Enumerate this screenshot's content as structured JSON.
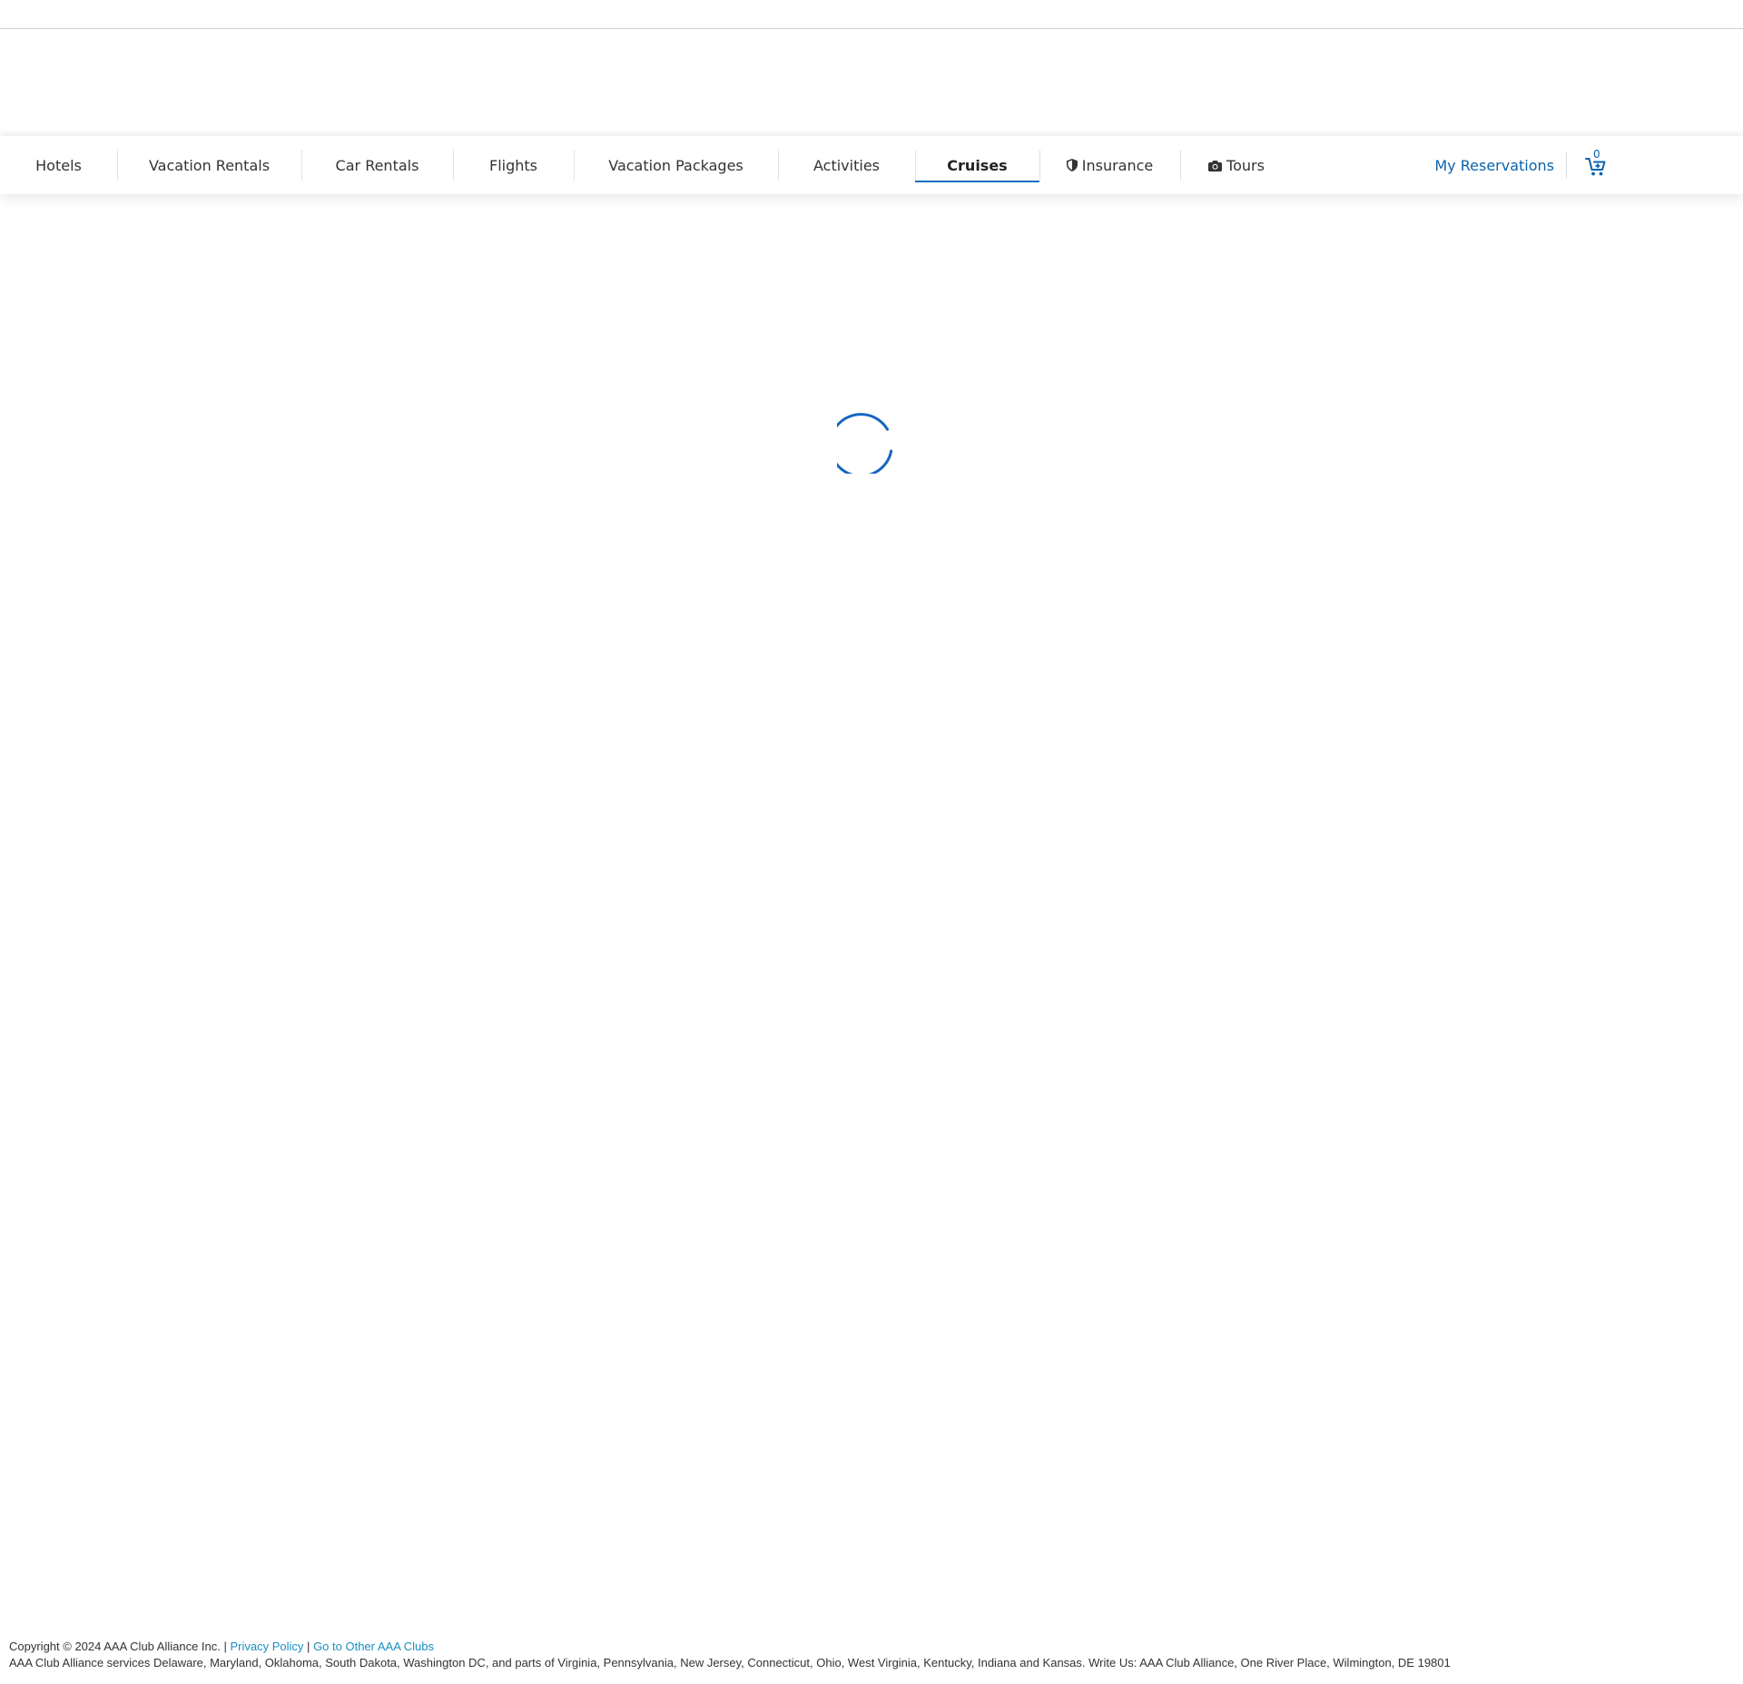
{
  "nav": {
    "tabs": [
      {
        "label": "Hotels"
      },
      {
        "label": "Vacation Rentals"
      },
      {
        "label": "Car Rentals"
      },
      {
        "label": "Flights"
      },
      {
        "label": "Vacation Packages"
      },
      {
        "label": "Activities"
      },
      {
        "label": "Cruises",
        "active": true
      },
      {
        "label": "Insurance",
        "icon": "shield-icon"
      },
      {
        "label": "Tours",
        "icon": "camera-icon"
      }
    ],
    "my_reservations": "My Reservations",
    "cart_count": "0",
    "cart_icon": "cart-icon"
  },
  "loading": {
    "icon": "spinner-icon"
  },
  "footer": {
    "copyright": "Copyright © 2024 AAA Club Alliance Inc. |",
    "privacy_link": "Privacy Policy",
    "separator": "|",
    "other_clubs_link": "Go to Other AAA Clubs",
    "services_text": "AAA Club Alliance services Delaware, Maryland, Oklahoma, South Dakota, Washington DC, and parts of Virginia, Pennsylvania, New Jersey, Connecticut, Ohio, West Virginia, Kentucky, Indiana and Kansas. Write Us: AAA Club Alliance, One River Place, Wilmington, DE 19801"
  },
  "colors": {
    "accent": "#1a6fc4",
    "link": "#0b63ad",
    "footer_link": "#1a8fbf",
    "text": "#333333"
  }
}
